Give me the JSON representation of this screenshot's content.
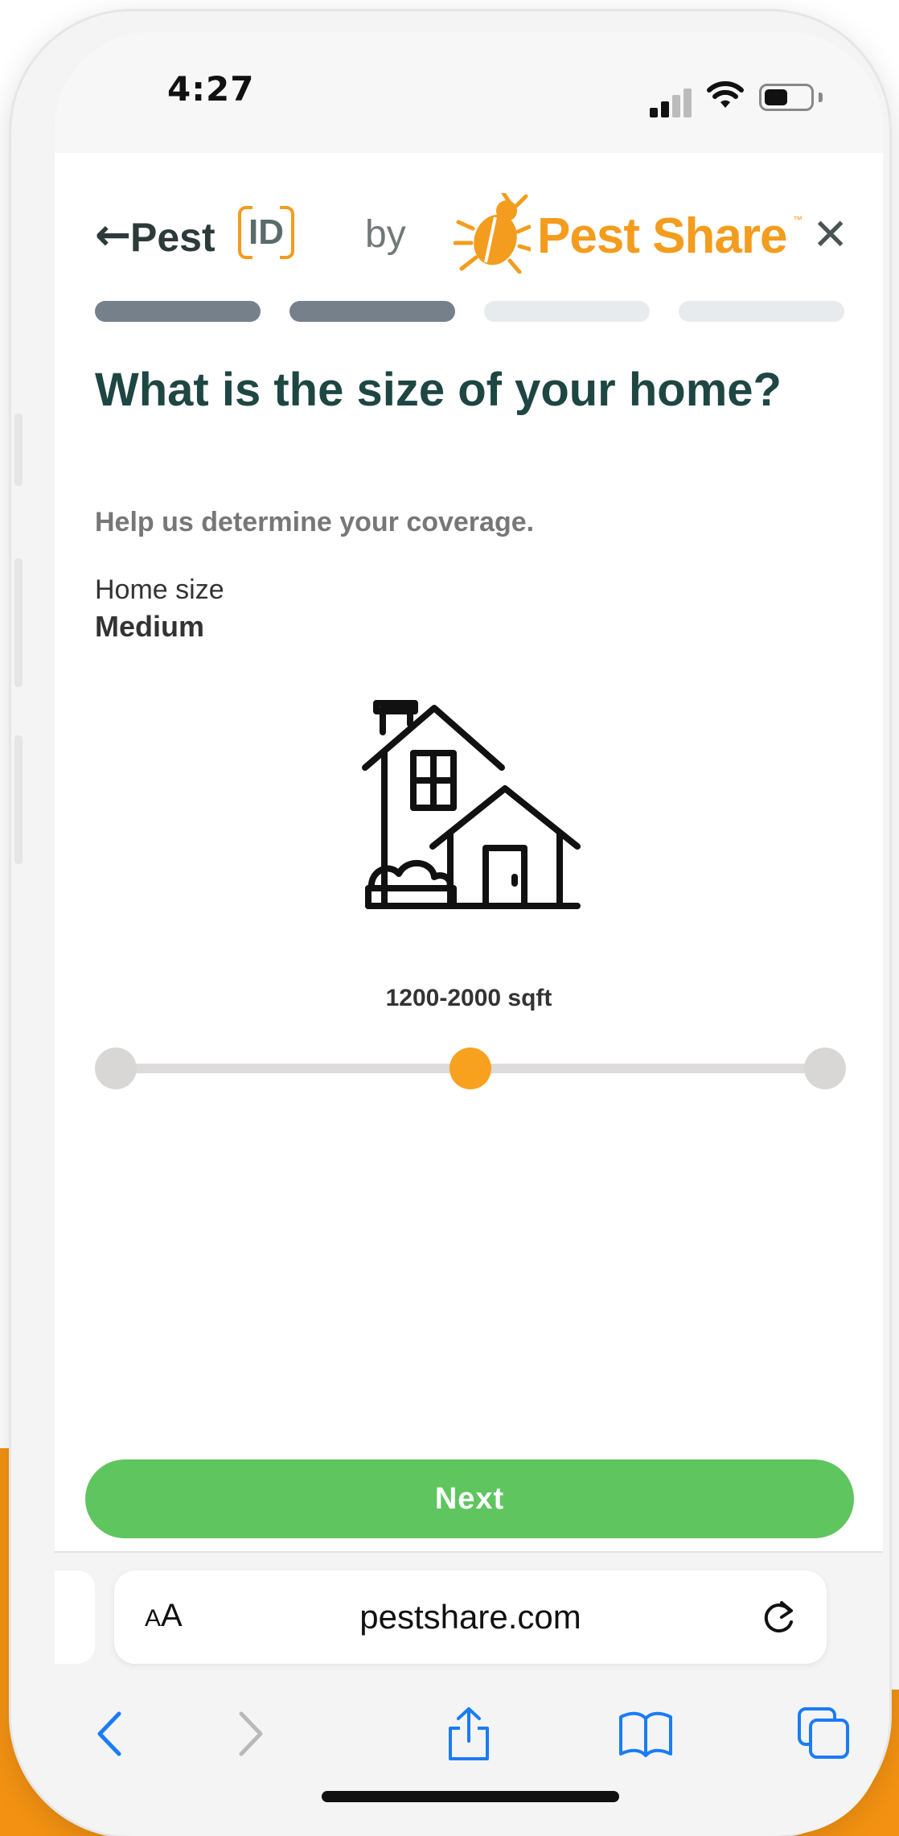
{
  "status_bar": {
    "time": "4:27"
  },
  "header": {
    "back_icon": "arrow-left-icon",
    "logo_pest": "Pest",
    "logo_id": "ID",
    "by": "by",
    "brand_icon": "bug-icon",
    "brand": "Pest Share",
    "trademark": "™",
    "close_icon": "close-icon"
  },
  "progress": {
    "total_steps": 4,
    "completed_steps": 2
  },
  "question": {
    "title": "What is the size of your home?",
    "helper": "Help us determine your coverage."
  },
  "home_size": {
    "label": "Home size",
    "value": "Medium",
    "icon": "house-icon",
    "range": "1200-2000 sqft",
    "slider_stops": 3,
    "selected_index": 1
  },
  "actions": {
    "next": "Next"
  },
  "browser": {
    "aa_small": "A",
    "aa_large": "A",
    "url": "pestshare.com",
    "reload_icon": "reload-icon",
    "nav": [
      "back-icon",
      "forward-icon",
      "share-icon",
      "bookmarks-icon",
      "tabs-icon"
    ]
  },
  "colors": {
    "accent_orange": "#f39c1d",
    "title_green": "#1e4643",
    "next_green": "#5fc55f",
    "ios_blue": "#1a7cf5"
  }
}
